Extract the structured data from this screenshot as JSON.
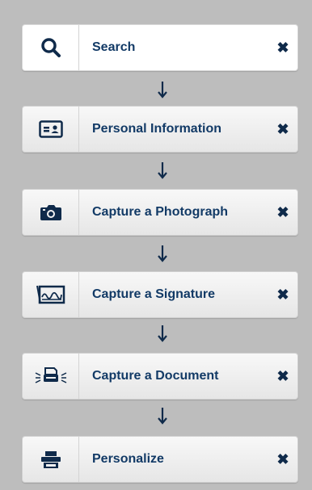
{
  "steps": [
    {
      "label": "Search",
      "icon": "search-icon",
      "close": "✖"
    },
    {
      "label": "Personal Information",
      "icon": "id-card-icon",
      "close": "✖"
    },
    {
      "label": "Capture a Photograph",
      "icon": "camera-icon",
      "close": "✖"
    },
    {
      "label": "Capture a Signature",
      "icon": "signature-icon",
      "close": "✖"
    },
    {
      "label": "Capture a Document",
      "icon": "scanner-icon",
      "close": "✖"
    },
    {
      "label": "Personalize",
      "icon": "printer-icon",
      "close": "✖"
    }
  ],
  "colors": {
    "background": "#bdbdbd",
    "accent": "#123a66",
    "icon": "#0f2a4a"
  }
}
